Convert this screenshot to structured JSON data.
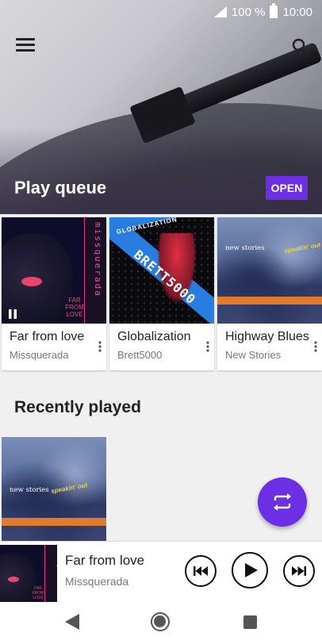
{
  "status": {
    "battery": "100 %",
    "time": "10:00"
  },
  "header": {
    "section_title": "Play queue",
    "open_label": "OPEN"
  },
  "queue": [
    {
      "title": "Far from love",
      "artist": "Missquerada",
      "art_text": "missquerada",
      "art_caption": "FAR FROM LOVE"
    },
    {
      "title": "Globalization",
      "artist": "Brett5000",
      "art_text": "BRETT5000",
      "art_caption": "GLOBALIZATION"
    },
    {
      "title": "Highway Blues",
      "artist": "New Stories",
      "art_text": "new stories",
      "art_caption": "speakin' out"
    }
  ],
  "recent": {
    "title": "Recently played",
    "art_text": "new stories",
    "art_caption": "speakin' out"
  },
  "player": {
    "title": "Far from love",
    "artist": "Missquerada",
    "art_text": "missquerada",
    "art_caption": "FAR FROM LOVE"
  },
  "colors": {
    "accent": "#6c2fe6",
    "text_primary": "#222222",
    "text_secondary": "#777777"
  },
  "icons": {
    "menu": "hamburger-menu-icon",
    "search": "search-icon",
    "fab": "repeat-shuffle-icon",
    "prev": "skip-previous-icon",
    "play": "play-icon",
    "next": "skip-next-icon"
  }
}
